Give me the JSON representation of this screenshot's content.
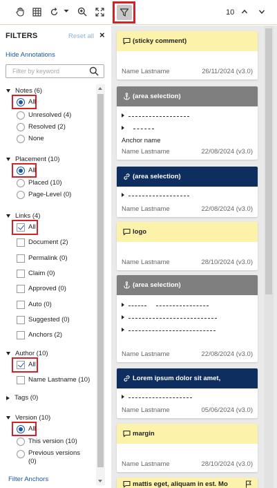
{
  "toolbar": {
    "tools": [
      "hand-icon",
      "grid-icon",
      "rotate-icon",
      "zoom-in-icon",
      "fit-icon"
    ],
    "count": "10"
  },
  "filters": {
    "title": "FILTERS",
    "reset": "Reset all",
    "close": "×",
    "hide_annotations": "Hide Annotations",
    "search_placeholder": "Filter by keyword",
    "notes": {
      "header": "Notes (6)",
      "options": [
        "All",
        "Unresolved (4)",
        "Resolved (2)",
        "None"
      ],
      "selected": "All"
    },
    "placement": {
      "header": "Placement (10)",
      "options": [
        "All",
        "Placed (10)",
        "Page-Level (0)"
      ],
      "selected": "All"
    },
    "links": {
      "header": "Links (4)",
      "options": [
        "All",
        "Document (2)",
        "Permalink (0)",
        "Claim (0)",
        "Approved (0)",
        "Auto (0)",
        "Suggested (0)",
        "Anchors (2)"
      ],
      "checked": [
        "All"
      ]
    },
    "author": {
      "header": "Author (10)",
      "options": [
        "All",
        "Name Lastname (10)"
      ],
      "checked": [
        "All"
      ]
    },
    "tags": {
      "header": "Tags (0)"
    },
    "version": {
      "header": "Version (10)",
      "options": [
        "All",
        "This version (10)",
        "Previous versions",
        "(0)"
      ],
      "selected": "All"
    },
    "filter_anchors": "Filter Anchors"
  },
  "annotations": [
    {
      "title": "(sticky comment)",
      "type": "note",
      "author": "Name Lastname",
      "date": "26/11/2024 (v3.0)"
    },
    {
      "title": "(area selection)",
      "type": "anchor",
      "author": "Name Lastname",
      "date": "22/08/2024 (v3.0)",
      "anchor_label": "Anchor name"
    },
    {
      "title": "(area selection)",
      "type": "link",
      "author": "Name Lastname",
      "date": "22/08/2024 (v3.0)"
    },
    {
      "title": "logo",
      "type": "note",
      "author": "Name Lastname",
      "date": "28/10/2024 (v3.0)"
    },
    {
      "title": "(area selection)",
      "type": "anchor",
      "author": "Name Lastname",
      "date": "22/08/2024 (v3.0)"
    },
    {
      "title": "Lorem ipsum dolor sit amet,",
      "type": "link",
      "author": "Name Lastname",
      "date": "05/06/2024 (v3.0)"
    },
    {
      "title": "margin",
      "type": "note",
      "author": "Name Lastname",
      "date": "28/10/2024 (v3.0)"
    },
    {
      "title": "mattis eget, aliquam in est. Mo",
      "type": "note"
    }
  ],
  "colors": {
    "highlight": "#d91f26",
    "link_blue": "#1a57a6",
    "note_yellow": "#fcf2a9",
    "anchor_grey": "#7f7f7f",
    "link_navy": "#0d2e5e"
  }
}
